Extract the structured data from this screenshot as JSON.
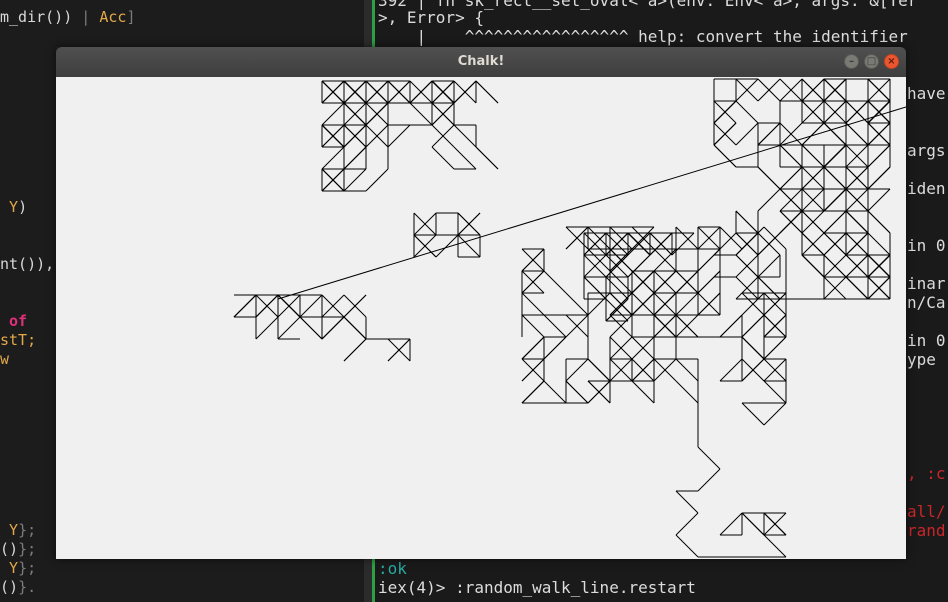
{
  "window": {
    "title": "Chalk!",
    "buttons": {
      "minimize": "–",
      "maximize": "□",
      "close": "×"
    }
  },
  "editor": {
    "lines": [
      [
        "m_dir()) ",
        "| ",
        "Acc",
        "]"
      ],
      [
        " Y",
        ")"
      ],
      [
        "nt()),"
      ],
      [
        " of"
      ],
      [
        "stT;"
      ],
      [
        "w"
      ],
      [
        " Y",
        "};"
      ],
      [
        "()",
        "};"
      ],
      [
        " Y",
        "};"
      ],
      [
        "()",
        "}."
      ]
    ]
  },
  "terminal": {
    "lines": [
      "392 | fn sk_rect__set_oval<'a>(env: Env<'a>, args: &[Ter",
      ">, Error> {",
      "    |    ^^^^^^^^^^^^^^^^^ help: convert the identifier",
      ":ok",
      "iex(4)> :random_walk_line.restart"
    ],
    "right_fragments": [
      "have",
      "args",
      "iden",
      "in 0",
      "inar",
      "n/Ca",
      "in 0",
      "ype",
      ", :c",
      "all/",
      "rand"
    ]
  },
  "colors": {
    "canvas_bg": "#f0f0f0",
    "line": "#000000",
    "titlebar": "#444444",
    "terminal_bg": "#1a1a1a",
    "editor_bg": "#1c1c1c",
    "accent_green": "#2ea043"
  }
}
